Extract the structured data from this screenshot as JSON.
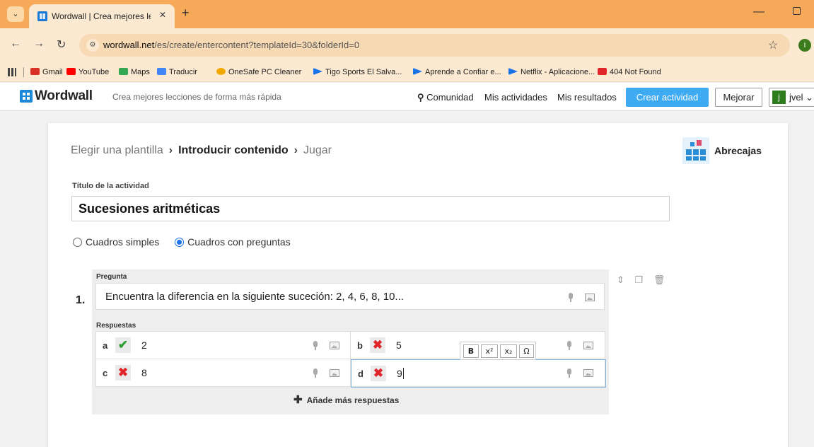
{
  "browser": {
    "tab_title": "Wordwall | Crea mejores leccion",
    "tab_close": "✕",
    "new_tab": "+",
    "url_host": "wordwall.net",
    "url_path": "/es/create/entercontent?templateId=30&folderId=0",
    "profile_initial": "i",
    "bookmarks": [
      {
        "label": "Gmail",
        "color": "#d93025"
      },
      {
        "label": "YouTube",
        "color": "#ff0000"
      },
      {
        "label": "Maps",
        "color": "#34a853"
      },
      {
        "label": "Traducir",
        "color": "#4285f4"
      },
      {
        "label": "OneSafe PC Cleaner",
        "color": "#f2a900"
      },
      {
        "label": "Tigo Sports El Salva...",
        "color": "#1a73e8"
      },
      {
        "label": "Aprende a Confiar e...",
        "color": "#1a73e8"
      },
      {
        "label": "Netflix - Aplicacione...",
        "color": "#1a73e8"
      },
      {
        "label": "404 Not Found",
        "color": "#e0262b"
      }
    ]
  },
  "header": {
    "logo_text": "Wordwall",
    "tagline": "Crea mejores lecciones de forma más rápida",
    "community": "Comunidad",
    "my_activities": "Mis actividades",
    "my_results": "Mis resultados",
    "create_activity": "Crear actividad",
    "upgrade": "Mejorar",
    "user_initial": "j",
    "user_name": "jvel"
  },
  "steps": {
    "step1": "Elegir una plantilla",
    "step2": "Introducir contenido",
    "step3": "Jugar",
    "template_name": "Abrecajas"
  },
  "form": {
    "title_label": "Título de la actividad",
    "title_value": "Sucesiones aritméticas",
    "mode_simple": "Cuadros simples",
    "mode_questions": "Cuadros con preguntas",
    "selected_mode": "Cuadros con preguntas"
  },
  "question": {
    "label": "Pregunta",
    "number": "1.",
    "text": "Encuentra la diferencia en la siguiente suceción: 2, 4, 6, 8, 10...",
    "answers_label": "Respuestas",
    "answers": [
      {
        "letter": "a",
        "correct": true,
        "text": "2"
      },
      {
        "letter": "b",
        "correct": false,
        "text": "5"
      },
      {
        "letter": "c",
        "correct": false,
        "text": "8"
      },
      {
        "letter": "d",
        "correct": false,
        "text": "9"
      }
    ],
    "add_more": "Añade más respuestas"
  },
  "format_toolbar": {
    "bold": "B",
    "superscript": "x²",
    "subscript": "x₂",
    "symbol": "Ω"
  },
  "colors": {
    "tabbar": "#f6a959",
    "create_button": "#3eaaf2",
    "correct": "#2e9c31",
    "incorrect": "#e0262b"
  }
}
